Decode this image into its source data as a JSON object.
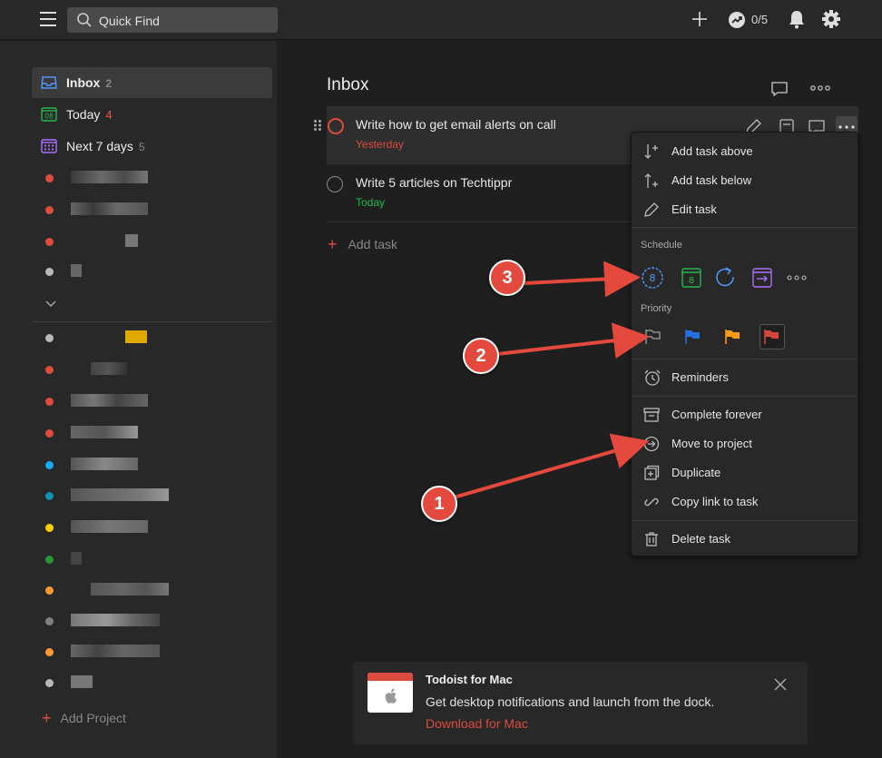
{
  "topbar": {
    "search_placeholder": "Quick Find",
    "karma": "0/5"
  },
  "sidebar": {
    "items": [
      {
        "label": "Inbox",
        "count": "2",
        "icon": "inbox-icon"
      },
      {
        "label": "Today",
        "count": "4",
        "icon": "calendar-today-icon",
        "icon_text": "08"
      },
      {
        "label": "Next 7 days",
        "count": "5",
        "icon": "calendar-week-icon"
      }
    ],
    "project_colors": [
      "#db4c3f",
      "#db4c3f",
      "#db4c3f",
      "#b8b8b8",
      "#b8b8b8",
      "#db4c3f",
      "#db4c3f",
      "#db4c3f",
      "#14aaf5",
      "#158fad",
      "#fad000",
      "#299438",
      "#ff9933",
      "#808080",
      "#ff9933",
      "#b8b8b8"
    ],
    "add_project": "Add Project"
  },
  "main": {
    "title": "Inbox",
    "tasks": [
      {
        "title": "Write how to get email alerts on call",
        "due": "Yesterday",
        "due_color": "#db4c3f"
      },
      {
        "title": "Write 5 articles on Techtippr",
        "due": "Today",
        "due_color": "#25b84c"
      }
    ],
    "add_task": "Add task"
  },
  "menu": {
    "add_above": "Add task above",
    "add_below": "Add task below",
    "edit": "Edit task",
    "schedule_label": "Schedule",
    "today_num": "8",
    "tomorrow_num": "8",
    "priority_label": "Priority",
    "reminders": "Reminders",
    "complete_forever": "Complete forever",
    "move_to_project": "Move to project",
    "duplicate": "Duplicate",
    "copy_link": "Copy link to task",
    "delete": "Delete task"
  },
  "annotations": [
    "1",
    "2",
    "3"
  ],
  "notification": {
    "title": "Todoist for Mac",
    "body": "Get desktop notifications and launch from the dock.",
    "link": "Download for Mac"
  },
  "colors": {
    "accent": "#db4c3f",
    "priority": [
      "#a0a0a0",
      "#246fe0",
      "#ff9a14",
      "#d1453b"
    ]
  }
}
